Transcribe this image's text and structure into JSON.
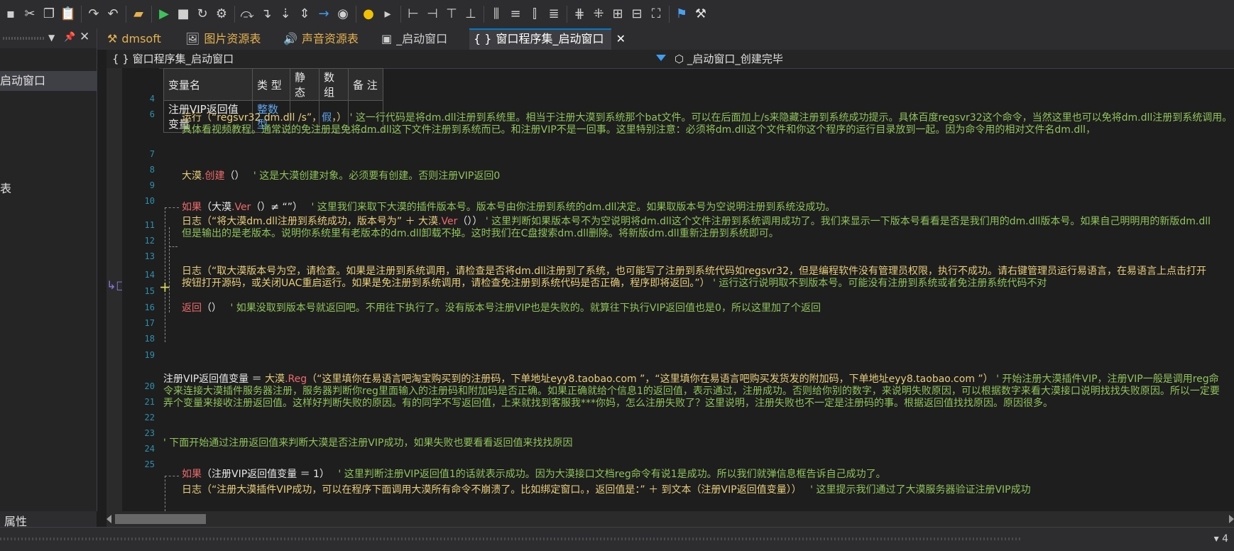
{
  "toolbar": {
    "icons": [
      "save-icon",
      "cut-icon",
      "copy-icon",
      "paste-icon",
      "redo-icon",
      "undo-icon",
      "open-folder-icon",
      "run-icon",
      "stop-icon",
      "restart-icon",
      "compile-icon",
      "step-over-icon",
      "step-into-icon",
      "step-down-icon",
      "step-both-icon",
      "jump-icon",
      "breakpoint-icon",
      "hint-bulb-icon",
      "bookmark-icon",
      "align-left-icon",
      "align-right-icon",
      "align-top-icon",
      "align-bottom-icon",
      "distribute-h-icon",
      "center-h-icon",
      "distribute-v-icon",
      "center-v-icon",
      "space-h-icon",
      "space-v-icon",
      "same-width-icon",
      "same-height-icon",
      "fullscreen-icon",
      "magic-wand-icon",
      "tools-icon"
    ]
  },
  "left_panel": {
    "header_controls": [
      "▼",
      "📌",
      "✕"
    ],
    "items": [
      {
        "label": "启动窗口",
        "selected": true
      },
      {
        "label": "表",
        "selected": false
      }
    ],
    "bottom_label": "属性"
  },
  "tabs": [
    {
      "label": "dmsoft",
      "icon": "⚒",
      "active": false,
      "color": "#e6b24a"
    },
    {
      "label": "图片资源表",
      "icon": "🖼",
      "active": false,
      "color": "#e6b24a"
    },
    {
      "label": "声音资源表",
      "icon": "🔊",
      "active": false,
      "color": "#e6b24a"
    },
    {
      "label": "_启动窗口",
      "icon": "▣",
      "active": false,
      "color": "#ffffff"
    },
    {
      "label": "窗口程序集_启动窗口",
      "icon": "{ }",
      "active": true,
      "color": "#ffffff",
      "close": "✕"
    }
  ],
  "navbar": {
    "left": "{ } 窗口程序集_启动窗口",
    "right": "⬡  _启动窗口_创建完毕"
  },
  "var_table": {
    "headers": [
      "变量名",
      "类 型",
      "静态",
      "数组",
      "备 注"
    ],
    "row": [
      "注册VIP返回值变量",
      "整数型",
      "",
      "",
      ""
    ]
  },
  "line_numbers": [
    "4",
    "6",
    "6",
    "7",
    "8",
    "9",
    "10",
    "11",
    "12",
    "13",
    "14",
    "15",
    "16",
    "17",
    "18",
    "19",
    "20",
    "21",
    "22",
    "23",
    "24",
    "25"
  ],
  "code": {
    "l4": "",
    "l6a": "运行（“regsvr32 dm.dll /s”，",
    "l6b": "假",
    "l6c": "，）",
    "l6comment": "' 这一行代码是将dm.dll注册到系统里。相当于注册大漠到系统那个bat文件。可以在后面加上/s来隐藏注册到系统成功提示。具体百度regsvr32这个命令，当然这里也可以免将dm.dll注册到系统调用。具体看视频教程。通常说的免注册是免将dm.dll这下文件注册到系统而已。和注册VIP不是一回事。这里特别注意：必须将dm.dll这个文件和你这个程序的运行目录放到一起。因为命令用的相对文件名dm.dll，",
    "l7a": "大漠",
    "l7b": ".创建",
    "l7c": "（）",
    "l7comment": "' 这是大漠创建对象。必须要有创建。否则注册VIP返回0",
    "l9a": "如果",
    "l9b": "（大漠",
    "l9c": ".Ver",
    "l9d": "（）≠ “”）",
    "l9comment": "' 这里我们来取下大漠的插件版本号。版本号由你注册到系统的dm.dll决定。如果取版本号为空说明注册到系统没成功。",
    "l10a": "日志",
    "l10b": "（“将大漠dm.dll注册到系统成功，版本号为” ＋ 大漠",
    "l10c": ".Ver",
    "l10d": "（））",
    "l10comment": "' 这里判断如果版本号不为空说明将dm.dll这个文件注册到系统调用成功了。我们来显示一下版本号看看是否是我们用的dm.dll版本号。如果自己明明用的新版dm.dll但是输出的是老版本。说明你系统里有老版本的dm.dll卸载不掉。这时我们在C盘搜索dm.dll删除。将新版dm.dll重新注册到系统即可。",
    "l13a": "日志",
    "l13b": "（“取大漠版本号为空，请检查。如果是注册到系统调用，请检查是否将dm.dll注册到了系统，也可能写了注册到系统代码如regsvr32，但是编程软件没有管理员权限，执行不成功。请右键管理员运行易语言，在易语言上点击打开按钮打开源码，或关闭UAC重启运行。如果是免注册到系统调用，请检查免注册到系统代码是否正确，程序即将返回。”）",
    "l13comment": "' 运行这行说明取不到版本号。可能没有注册到系统或者免注册系统代码不对",
    "l15a": "返回",
    "l15b": "（）",
    "l15comment": "' 如果没取到版本号就返回吧。不用往下执行了。没有版本号注册VIP也是失败的。就算往下执行VIP返回值也是0，所以这里加了个返回",
    "l19a": "注册VIP返回值变量 ＝ ",
    "l19b": "大漠",
    "l19c": ".Reg",
    "l19d": "（“这里填你在易语言吧淘宝购买到的注册码，下单地址eyy8.taobao.com ”，“这里填你在易语言吧购买发货发的附加码，下单地址eyy8.taobao.com ”）",
    "l19comment": "' 开始注册大漠插件VIP，注册VIP一般是调用reg命令来连接大漠插件服务器注册，服务器判断你reg里面输入的注册码和附加码是否正确。如果正确就给个信息1的返回值，表示通过，注册成功。否则给你别的数字，来说明失败原因，可以根据数字来看大漠接口说明找找失败原因。所以一定要弄个变量来接收注册返回值。这样好判断失败的原因。有的同学不写返回值，上来就找到客服我***你妈，怎么注册失败了？这里说明，注册失败也不一定是注册码的事。根据返回值找找原因。原因很多。",
    "l21comment": "' 下面开始通过注册返回值来判断大漠是否注册VIP成功，如果失败也要看看返回值来找找原因",
    "l23a": "如果",
    "l23b": "（注册VIP返回值变量 ＝ 1）",
    "l23comment": "' 这里判断注册VIP返回值1的话就表示成功。因为大漠接口文档reg命令有说1是成功。所以我们就弹信息框告诉自己成功了。",
    "l24a": "日志",
    "l24b": "（“注册大漠插件VIP成功，可以在程序下面调用大漠所有命令不崩溃了。比如绑定窗口。，返回值是：” ＋ 到文本（注册VIP返回值变量））",
    "l24comment": "' 这里提示我们通过了大漠服务器验证注册VIP成功"
  },
  "status": {
    "right": "▾ 4"
  }
}
